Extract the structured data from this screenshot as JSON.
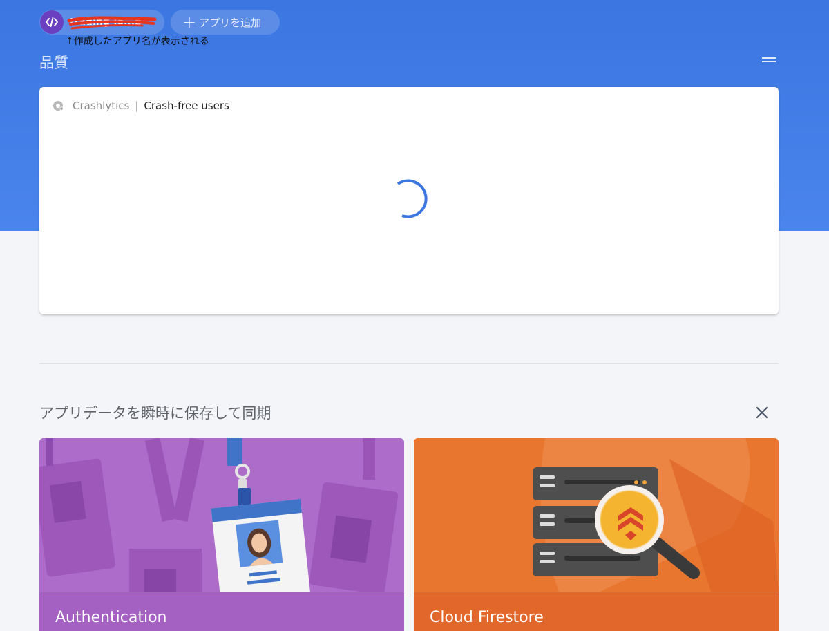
{
  "header": {
    "app_name": "trading-io...b",
    "app_icon": "code-icon",
    "add_app_label": "アプリを追加",
    "annotation": "↑作成したアプリ名が表示される"
  },
  "quality_section": {
    "title": "品質",
    "menu_icon": "menu-icon"
  },
  "crash_card": {
    "service": "Crashlytics",
    "separator": "|",
    "metric": "Crash-free users",
    "loading": true
  },
  "sync_section": {
    "title": "アプリデータを瞬時に保存して同期",
    "close_icon": "close-icon",
    "cards": [
      {
        "label": "Authentication",
        "color": "#a868c7"
      },
      {
        "label": "Cloud Firestore",
        "color": "#e8762e"
      }
    ]
  },
  "colors": {
    "hero": "#3b76e1",
    "spinner": "#3b76e1",
    "page_bg": "#f4f5f8"
  }
}
